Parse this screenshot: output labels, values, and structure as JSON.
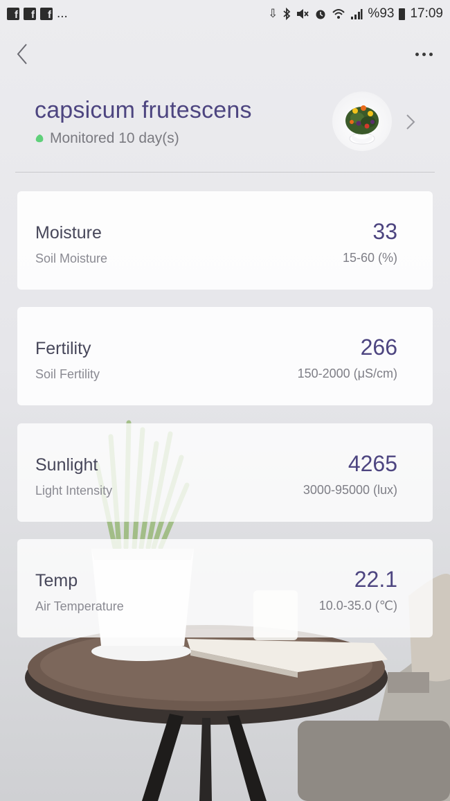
{
  "status_bar": {
    "left_icons": [
      "facebook-icon",
      "facebook-icon",
      "facebook-icon"
    ],
    "overflow": "...",
    "battery": "%93",
    "time": "17:09"
  },
  "header": {
    "plant_name": "capsicum frutescens",
    "monitored_text": "Monitored 10 day(s)",
    "status_color": "#5fd07a"
  },
  "metrics": [
    {
      "title": "Moisture",
      "subtitle": "Soil Moisture",
      "value": "33",
      "range": "15-60 (%)"
    },
    {
      "title": "Fertility",
      "subtitle": "Soil Fertility",
      "value": "266",
      "range": "150-2000 (μS/cm)"
    },
    {
      "title": "Sunlight",
      "subtitle": "Light Intensity",
      "value": "4265",
      "range": "3000-95000 (lux)"
    },
    {
      "title": "Temp",
      "subtitle": "Air Temperature",
      "value": "22.1",
      "range": "10.0-35.0 (℃)"
    }
  ],
  "colors": {
    "accent": "#4d4580",
    "background": "#ececef"
  }
}
